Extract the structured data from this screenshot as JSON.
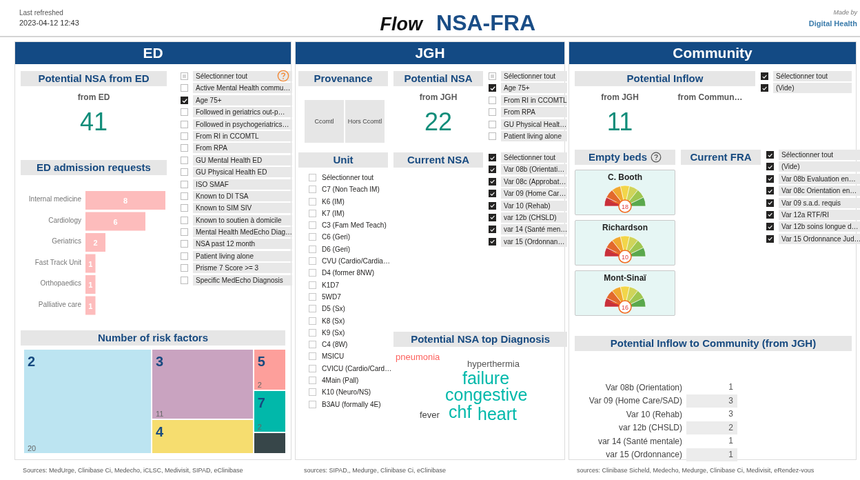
{
  "header": {
    "refreshed_label": "Last refreshed",
    "refreshed_time": "2023-04-12 12:43",
    "title_prefix": "Flow",
    "title": "NSA-FRA",
    "made_by_label": "Made by",
    "made_by": "Digital Health"
  },
  "ed": {
    "heading": "ED",
    "potential": {
      "title": "Potential NSA from ED",
      "subtitle": "from ED",
      "value": "41"
    },
    "filters": [
      {
        "label": "Sélectionner tout",
        "checked": false
      },
      {
        "label": "Active Mental Health commu…",
        "checked": false
      },
      {
        "label": "Age 75+",
        "checked": true
      },
      {
        "label": "Followed in geriatrics out-p…",
        "checked": false
      },
      {
        "label": "Followed in psychogeriatrics…",
        "checked": false
      },
      {
        "label": "From RI in CCOMTL",
        "checked": false
      },
      {
        "label": "From RPA",
        "checked": false
      },
      {
        "label": "GU Mental Health ED",
        "checked": false
      },
      {
        "label": "GU Physical Health ED",
        "checked": false
      },
      {
        "label": "ISO SMAF",
        "checked": false
      },
      {
        "label": "Known to DI TSA",
        "checked": false
      },
      {
        "label": "Known to SIM SIV",
        "checked": false
      },
      {
        "label": "Known to soutien à domicile",
        "checked": false
      },
      {
        "label": "Mental Health MedEcho Diag…",
        "checked": false
      },
      {
        "label": "NSA past 12 month",
        "checked": false
      },
      {
        "label": "Patient living alone",
        "checked": false
      },
      {
        "label": "Prisme 7 Score >= 3",
        "checked": false
      },
      {
        "label": "Specific MedEcho Diagnosis",
        "checked": false
      }
    ],
    "admissions": {
      "title": "ED admission requests",
      "chart_data": {
        "type": "bar",
        "orientation": "horizontal",
        "categories": [
          "Internal medicine",
          "Cardiology",
          "Geriatrics",
          "Fast Track Unit",
          "Orthopaedics",
          "Palliative care"
        ],
        "values": [
          8,
          6,
          2,
          1,
          1,
          1
        ],
        "data_labels": true
      }
    },
    "risk": {
      "title": "Number of risk factors",
      "tiles": [
        {
          "label": "2",
          "count": "20",
          "color": "#bce4f1"
        },
        {
          "label": "3",
          "count": "11",
          "color": "#c9a3c0"
        },
        {
          "label": "4",
          "color": "#f6dd6f"
        },
        {
          "label": "5",
          "count": "2",
          "color": "#fd9f9b"
        },
        {
          "label": "7",
          "count": "2",
          "color": "#01b8aa"
        },
        {
          "color": "#374649"
        }
      ]
    },
    "sources": "Sources: MedUrge, Clinibase Ci, Medecho, iCLSC, Medivisit, SIPAD, eClinibase"
  },
  "jgh": {
    "heading": "JGH",
    "provenance": {
      "title": "Provenance",
      "options": [
        "Ccomtl",
        "Hors Ccomtl"
      ]
    },
    "potential": {
      "title": "Potential NSA",
      "subtitle": "from JGH",
      "value": "22"
    },
    "filters": [
      {
        "label": "Sélectionner tout",
        "checked": false
      },
      {
        "label": "Age 75+",
        "checked": true
      },
      {
        "label": "From RI in CCOMTL",
        "checked": false
      },
      {
        "label": "From RPA",
        "checked": false
      },
      {
        "label": "GU Physical Healt…",
        "checked": false
      },
      {
        "label": "Patient living alone",
        "checked": false
      }
    ],
    "unit": {
      "title": "Unit",
      "items": [
        {
          "label": "Sélectionner tout",
          "checked": false
        },
        {
          "label": "C7 (Non Teach IM)",
          "checked": false
        },
        {
          "label": "K6 (IM)",
          "checked": false
        },
        {
          "label": "K7 (IM)",
          "checked": false
        },
        {
          "label": "C3 (Fam Med Teach)",
          "checked": false
        },
        {
          "label": "C6 (Geri)",
          "checked": false
        },
        {
          "label": "D6 (Geri)",
          "checked": false
        },
        {
          "label": "CVU (Cardio/Cardia…",
          "checked": false
        },
        {
          "label": "D4 (former 8NW)",
          "checked": false
        },
        {
          "label": "K1D7",
          "checked": false
        },
        {
          "label": "5WD7",
          "checked": false
        },
        {
          "label": "D5 (Sx)",
          "checked": false
        },
        {
          "label": "K8 (Sx)",
          "checked": false
        },
        {
          "label": "K9 (Sx)",
          "checked": false
        },
        {
          "label": "C4 (8W)",
          "checked": false
        },
        {
          "label": "MSICU",
          "checked": false
        },
        {
          "label": "CVICU (Cardio/Card…",
          "checked": false
        },
        {
          "label": "4Main (Pall)",
          "checked": false
        },
        {
          "label": "K10 (Neuro/NS)",
          "checked": false
        },
        {
          "label": "B3AU (formally 4E)",
          "checked": false
        }
      ]
    },
    "current": {
      "title": "Current NSA",
      "filters": [
        {
          "label": "Sélectionner tout",
          "checked": true
        },
        {
          "label": "Var 08b (Orientati…",
          "checked": true
        },
        {
          "label": "Var 08c (Approbat…",
          "checked": true
        },
        {
          "label": "Var 09 (Home Car…",
          "checked": true
        },
        {
          "label": "Var 10 (Rehab)",
          "checked": true
        },
        {
          "label": "var 12b (CHSLD)",
          "checked": true
        },
        {
          "label": "var 14 (Santé men…",
          "checked": true
        },
        {
          "label": "var 15 (Ordonnan…",
          "checked": true
        }
      ]
    },
    "diagnosis": {
      "title": "Potential NSA top Diagnosis",
      "words": [
        {
          "text": "pneumonia",
          "color": "#fd625e",
          "kind": "medium"
        },
        {
          "text": "hyperthermia",
          "color": "#555555",
          "kind": "medium"
        },
        {
          "text": "failure",
          "color": "#01b8aa",
          "kind": "large"
        },
        {
          "text": "congestive",
          "color": "#01b8aa",
          "kind": "large"
        },
        {
          "text": "fever",
          "color": "#444444",
          "kind": "medium"
        },
        {
          "text": "chf",
          "color": "#01b8aa",
          "kind": "large"
        },
        {
          "text": "heart",
          "color": "#01b8aa",
          "kind": "large"
        }
      ]
    },
    "sources": "sources: SIPAD,, Medurge, Clinibase Ci, eClinibase"
  },
  "community": {
    "heading": "Community",
    "inflow": {
      "title": "Potential  Inflow",
      "stats": [
        {
          "subtitle": "from JGH",
          "value": "11"
        },
        {
          "subtitle": "from Commun…"
        }
      ],
      "filters": [
        {
          "label": "Sélectionner tout",
          "checked": true
        },
        {
          "label": "(Vide)",
          "checked": true
        }
      ]
    },
    "beds": {
      "title": "Empty beds",
      "sites": [
        {
          "name": "C. Booth",
          "value": "18"
        },
        {
          "name": "Richardson",
          "value": "10"
        },
        {
          "name": "Mont-Sinaï",
          "value": "16"
        }
      ]
    },
    "fra": {
      "title": "Current FRA",
      "filters": [
        {
          "label": "Sélectionner tout",
          "checked": true
        },
        {
          "label": "(Vide)",
          "checked": true
        },
        {
          "label": "Var 08b Evaluation en…",
          "checked": true
        },
        {
          "label": "Var 08c Orientation en…",
          "checked": true
        },
        {
          "label": "Var 09 s.a.d. requis",
          "checked": true
        },
        {
          "label": "Var 12a RTF/RI",
          "checked": true
        },
        {
          "label": "Var 12b soins longue d…",
          "checked": true
        },
        {
          "label": "Var 15 Ordonnance Jud…",
          "checked": true
        }
      ]
    },
    "table": {
      "title": "Potential Inflow to Community (from JGH)",
      "rows": [
        {
          "label": "Var 08b (Orientation)",
          "value": "1"
        },
        {
          "label": "Var 09 (Home Care/SAD)",
          "value": "3"
        },
        {
          "label": "Var 10 (Rehab)",
          "value": "3"
        },
        {
          "label": "var 12b (CHSLD)",
          "value": "2"
        },
        {
          "label": "var 14 (Santé mentale)",
          "value": "1"
        },
        {
          "label": "var 15 (Ordonnance)",
          "value": "1"
        }
      ]
    },
    "sources": "sources: Clinibase Sicheld, Medecho, Medurge, Clinibase Ci, Medivisit, eRendez-vous"
  }
}
